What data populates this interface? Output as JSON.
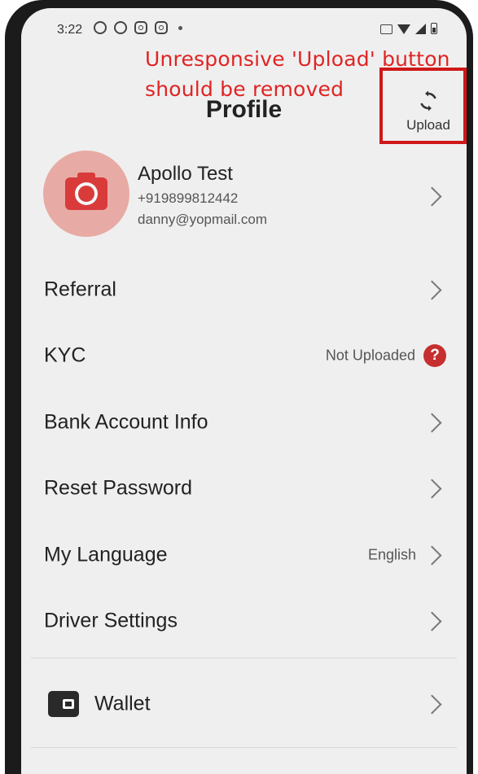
{
  "status_bar": {
    "time": "3:22"
  },
  "annotation": {
    "line1": "Unresponsive 'Upload' button",
    "line2": "should be removed",
    "color": "#e02424"
  },
  "header": {
    "title": "Profile",
    "upload_label": "Upload"
  },
  "profile": {
    "name": "Apollo Test",
    "phone": "+919899812442",
    "email": "danny@yopmail.com"
  },
  "menu": {
    "referral": "Referral",
    "kyc": "KYC",
    "kyc_status": "Not Uploaded",
    "bank": "Bank Account Info",
    "reset_password": "Reset Password",
    "language": "My Language",
    "language_value": "English",
    "driver_settings": "Driver Settings",
    "wallet": "Wallet"
  },
  "colors": {
    "accent_red": "#c62f2f",
    "avatar_bg": "#e8aaa4"
  }
}
